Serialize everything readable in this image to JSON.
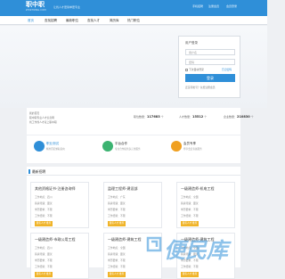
{
  "header": {
    "logo_title": "职中职",
    "logo_sub": "ZHIZHONG.COM",
    "slogan": "让找人才更简单更专业",
    "links": [
      "手机招聘",
      "注册会员",
      "会员登录"
    ]
  },
  "nav": {
    "items": [
      "首页",
      "查找招聘",
      "最新职位",
      "查找人才",
      "简历库",
      "热门职位"
    ]
  },
  "login": {
    "title": "用户登录",
    "username_placeholder": "用户名",
    "password_placeholder": "密码",
    "remember_label": "下次自动登录",
    "forgot_label": "忘记密码",
    "submit_label": "登录",
    "register_text": "还没有帐号？免费注册会员"
  },
  "stats": {
    "intro": [
      "我的首页",
      "职中职专业人才信息网",
      "找工作找人才就上职中职"
    ],
    "items": [
      {
        "label": "职位数量",
        "value": "117683",
        "unit": "个"
      },
      {
        "label": "人才数量",
        "value": "15512",
        "unit": "个"
      },
      {
        "label": "企业数量",
        "value": "210830",
        "unit": "个"
      }
    ]
  },
  "features": [
    {
      "title": "职业测试",
      "desc": "精准匹配求职意向",
      "color": "#2f8fd8"
    },
    {
      "title": "平台合作",
      "desc": "专业合作提供多元化服务",
      "color": "#3cb371"
    },
    {
      "title": "会员专享",
      "desc": "尊享会员专属服务",
      "color": "#f0a020"
    }
  ],
  "section": {
    "title": "最新招聘"
  },
  "jobs": [
    {
      "name": "其他资格证书-注册咨询师",
      "loc": "工作地点：四川",
      "pay": "薪资待遇：面议",
      "edu": "学历要求：不限",
      "exp": "工作经验：不限",
      "btn": "我有人才 推荐"
    },
    {
      "name": "监理工程师-建设部",
      "loc": "工作地点：广东",
      "pay": "薪资待遇：面议",
      "edu": "学历要求：不限",
      "exp": "工作经验：不限",
      "btn": "我有人才 推荐"
    },
    {
      "name": "一级建造师-机电工程",
      "loc": "工作地点：全国",
      "pay": "薪资待遇：面议",
      "edu": "学历要求：不限",
      "exp": "工作经验：不限",
      "btn": "我有人才 推荐"
    },
    {
      "name": "一级建造师-市政公用工程",
      "loc": "工作地点：四川",
      "pay": "薪资待遇：面议",
      "edu": "学历要求：不限",
      "exp": "工作经验：不限",
      "btn": "我有人才 推荐"
    },
    {
      "name": "一级建造师-建筑工程",
      "loc": "工作地点：全国",
      "pay": "薪资待遇：面议",
      "edu": "学历要求：不限",
      "exp": "工作经验：不限",
      "btn": "我有人才 推荐"
    },
    {
      "name": "一级建造师-建筑工程",
      "loc": "工作地点：全国",
      "pay": "薪资待遇：面议",
      "edu": "学历要求：不限",
      "exp": "工作经验：不限",
      "btn": "我有人才 推荐"
    }
  ],
  "watermark": "便民库"
}
